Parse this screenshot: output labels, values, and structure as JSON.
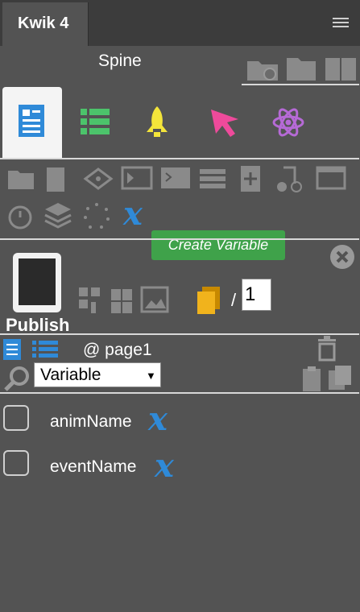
{
  "panel": {
    "tab_label": "Kwik 4",
    "menu_icon": "hamburger-menu-icon"
  },
  "header": {
    "title": "Spine"
  },
  "tooltip": {
    "text": "Create Variable"
  },
  "publish": {
    "label": "Publish",
    "page_number": "1",
    "separator": "/"
  },
  "page_list": {
    "page_label": "@ page1"
  },
  "filter": {
    "selected": "Variable"
  },
  "variables": [
    {
      "name": "animName"
    },
    {
      "name": "eventName"
    }
  ],
  "colors": {
    "accent_blue": "#2f8ad8",
    "tooltip_green": "#3fa24a",
    "panel_bg": "#535353"
  }
}
